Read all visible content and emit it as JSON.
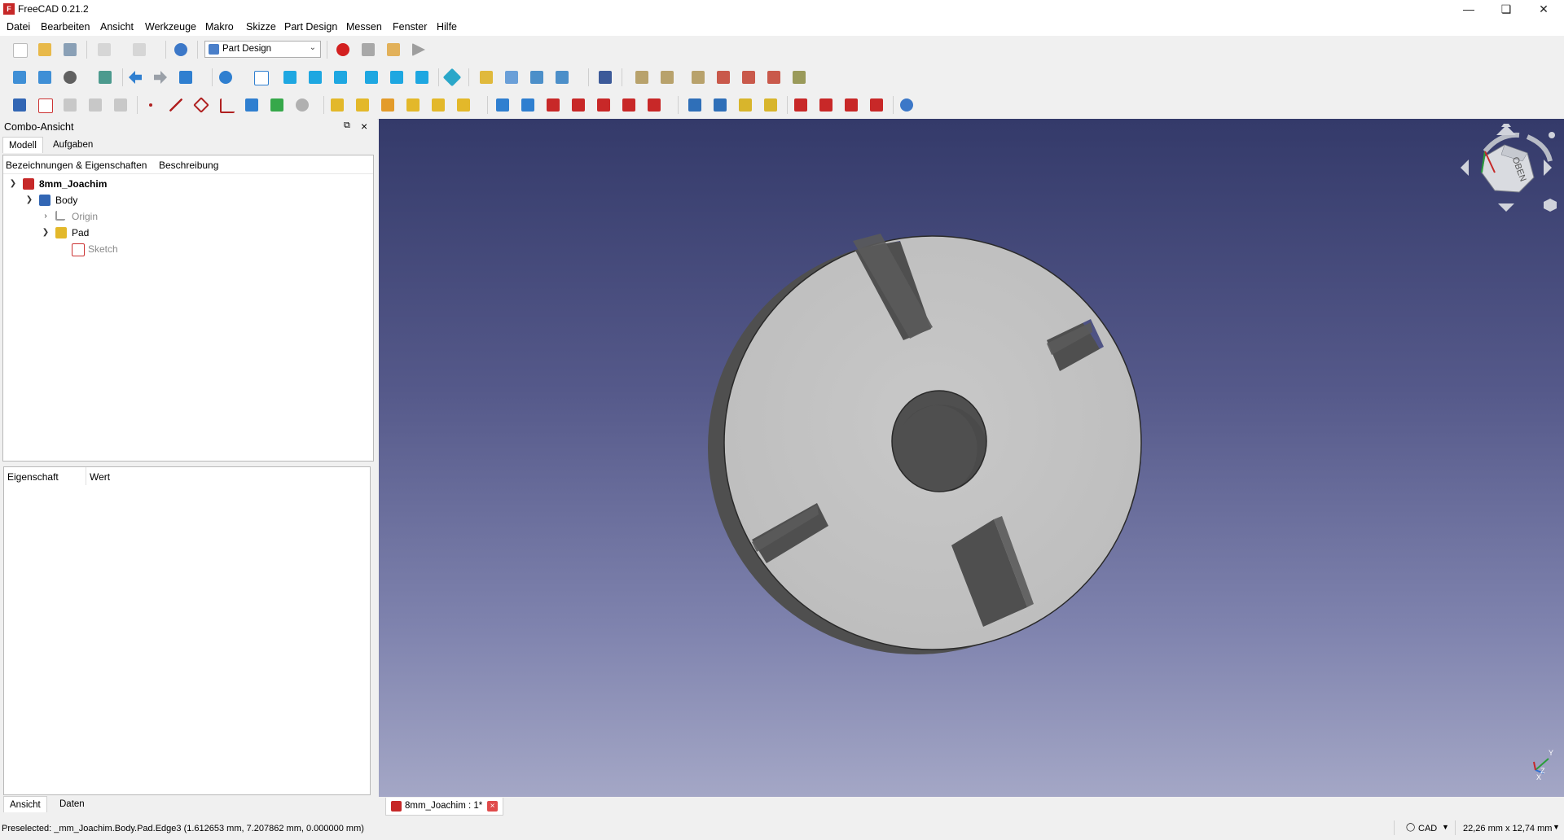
{
  "window": {
    "title": "FreeCAD 0.21.2"
  },
  "menu": [
    "Datei",
    "Bearbeiten",
    "Ansicht",
    "Werkzeuge",
    "Makro",
    "Skizze",
    "Part Design",
    "Messen",
    "Fenster",
    "Hilfe"
  ],
  "workbench": {
    "selected": "Part Design"
  },
  "combo": {
    "title": "Combo-Ansicht",
    "tabs": [
      "Modell",
      "Aufgaben"
    ],
    "tree_columns": [
      "Bezeichnungen & Eigenschaften",
      "Beschreibung"
    ],
    "tree": [
      {
        "label": "8mm_Joachim",
        "expanded": true
      },
      {
        "label": "Body",
        "expanded": true
      },
      {
        "label": "Origin",
        "expanded": false
      },
      {
        "label": "Pad",
        "expanded": true
      },
      {
        "label": "Sketch"
      }
    ],
    "props_columns": [
      "Eigenschaft",
      "Wert"
    ],
    "bottom_tabs": [
      "Ansicht",
      "Daten"
    ]
  },
  "navcube": {
    "face": "OBEN"
  },
  "axis": {
    "y": "Y",
    "z": "Z",
    "x": "X"
  },
  "document_tab": {
    "label": "8mm_Joachim : 1*"
  },
  "status": {
    "message": "Preselected: _mm_Joachim.Body.Pad.Edge3 (1.612653 mm, 7.207862 mm, 0.000000 mm)",
    "nav_style": "CAD",
    "dimensions": "22,26 mm x 12,74 mm"
  },
  "colors": {
    "bg_top": "#343a6a",
    "bg_bottom": "#a4a7c6",
    "part_face": "#c4c4c4",
    "part_side": "#5a5a5a"
  }
}
